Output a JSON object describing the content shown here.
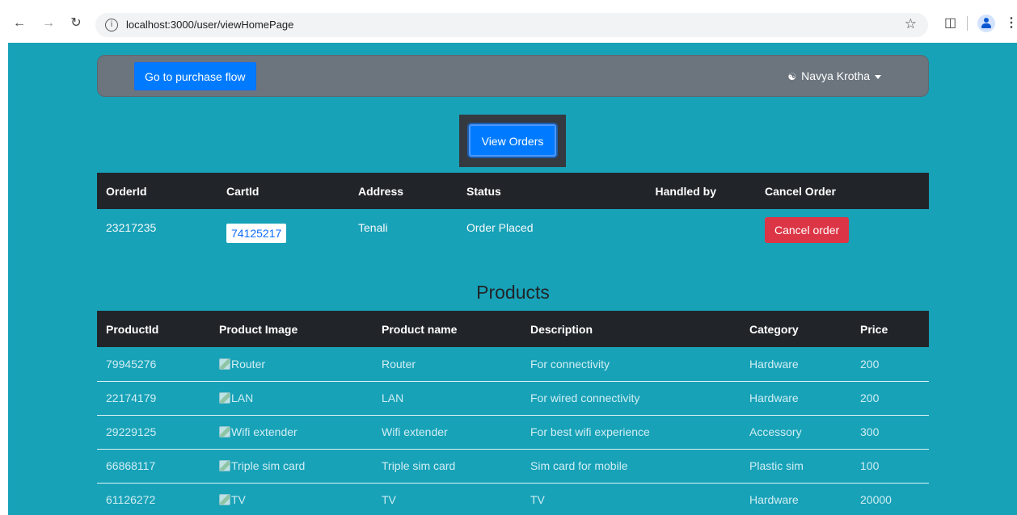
{
  "browser": {
    "url": "localhost:3000/user/viewHomePage"
  },
  "navbar": {
    "purchase_button": "Go to purchase flow",
    "user_name": "Navya Krotha"
  },
  "view_orders_button": "View Orders",
  "orders": {
    "headers": [
      "OrderId",
      "CartId",
      "Address",
      "Status",
      "Handled by",
      "Cancel Order"
    ],
    "rows": [
      {
        "order_id": "23217235",
        "cart_id": "74125217",
        "address": "Tenali",
        "status": "Order Placed",
        "handled_by": "",
        "cancel_label": "Cancel order"
      }
    ]
  },
  "products": {
    "title": "Products",
    "headers": [
      "ProductId",
      "Product Image",
      "Product name",
      "Description",
      "Category",
      "Price"
    ],
    "rows": [
      {
        "id": "79945276",
        "image_alt": "Router",
        "name": "Router",
        "description": "For connectivity",
        "category": "Hardware",
        "price": "200"
      },
      {
        "id": "22174179",
        "image_alt": "LAN",
        "name": "LAN",
        "description": "For wired connectivity",
        "category": "Hardware",
        "price": "200"
      },
      {
        "id": "29229125",
        "image_alt": "Wifi extender",
        "name": "Wifi extender",
        "description": "For best wifi experience",
        "category": "Accessory",
        "price": "300"
      },
      {
        "id": "66868117",
        "image_alt": "Triple sim card",
        "name": "Triple sim card",
        "description": "Sim card for mobile",
        "category": "Plastic sim",
        "price": "100"
      },
      {
        "id": "61126272",
        "image_alt": "TV",
        "name": "TV",
        "description": "TV",
        "category": "Hardware",
        "price": "20000"
      }
    ]
  },
  "colors": {
    "page_bg": "#17a2b8",
    "navbar_bg": "#6c757d",
    "primary": "#007bff",
    "danger": "#dc3545",
    "table_header": "#212529"
  },
  "icons": [
    "back-arrow-icon",
    "forward-arrow-icon",
    "reload-icon",
    "info-icon",
    "bookmark-star-icon",
    "extensions-icon",
    "profile-icon",
    "menu-dots-icon",
    "person-icon",
    "caret-down-icon",
    "broken-image-icon"
  ]
}
